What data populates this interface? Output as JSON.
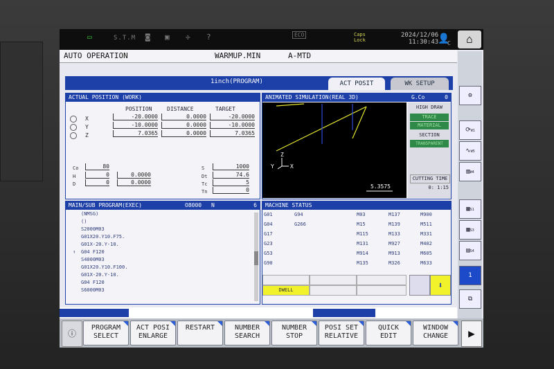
{
  "status": {
    "sim_label": "S.T.M",
    "eco": "ECO",
    "caps_line1": "Caps",
    "caps_line2": "Lock",
    "date": "2024/12/06",
    "time": "11:30:43",
    "user_badge": "C"
  },
  "mode": {
    "operation": "AUTO OPERATION",
    "program_file": "WARMUP.MIN",
    "mtd": "A-MTD"
  },
  "tabs": {
    "program_unit": "1inch(PROGRAM)",
    "act_posit": "ACT POSIT",
    "wk_setup": "WK SETUP"
  },
  "actual_position": {
    "title": "ACTUAL POSITION (WORK)",
    "headers": [
      "POSITION",
      "DISTANCE",
      "TARGET"
    ],
    "rows": [
      {
        "axis": "X",
        "position": "-20.0000",
        "distance": "0.0000",
        "target": "-20.0000"
      },
      {
        "axis": "Y",
        "position": "-10.0000",
        "distance": "0.0000",
        "target": "-10.0000"
      },
      {
        "axis": "Z",
        "position": "7.0365",
        "distance": "0.0000",
        "target": "7.0365"
      }
    ],
    "co_label": "Co",
    "co_value": "80",
    "h_label": "H",
    "h_num": "0",
    "h_value": "0.0000",
    "d_label": "D",
    "d_num": "0",
    "d_value": "0.0000",
    "s_label": "S",
    "s_value": "1000",
    "dt_label": "Dt",
    "dt_value": "74.6",
    "tc_label": "Tc",
    "tc_value": "5",
    "tn_label": "Tn",
    "tn_value": "0"
  },
  "simulation": {
    "title": "ANIMATED SIMULATION(REAL 3D)",
    "gco_label": "G.Co",
    "gco_value": "0",
    "high_draw": "HIGH DRAW",
    "trace": "TRACE",
    "material": "MATERIAL",
    "section": "SECTION",
    "transparent": "TRANSPARENT",
    "cutting_time_label": "CUTTING TIME",
    "cutting_time": "0: 1:15",
    "scale": "5.3575",
    "axis_z": "Z",
    "axis_y": "Y",
    "axis_x": "X"
  },
  "program": {
    "title": "MAIN/SUB PROGRAM(EXEC)",
    "onum": "O8000",
    "n_label": "N",
    "count": "6",
    "lines": [
      "(NMSG)",
      "()",
      "S2000M03",
      "G01X20.Y10.F75.",
      "G01X-20.Y-10.",
      "G04 F120",
      "S4000M03",
      "G01X20.Y10.F100.",
      "G01X-20.Y-10.",
      "G04 F120",
      "S6000M03"
    ]
  },
  "machine_status": {
    "title": "MACHINE STATUS",
    "col1": [
      "G01",
      "G04",
      "G17",
      "G23",
      "G53",
      "G90"
    ],
    "col2": [
      "G94",
      "G266",
      "",
      "",
      "",
      ""
    ],
    "col3": [
      "M03",
      "M15",
      "M115",
      "M131",
      "M914",
      "M135"
    ],
    "col4": [
      "M137",
      "M139",
      "M133",
      "M927",
      "M913",
      "M326"
    ],
    "col5": [
      "M900",
      "M511",
      "M331",
      "M402",
      "M605",
      "M633"
    ],
    "dwell": "DWELL"
  },
  "side": {
    "w1": "W1",
    "w5": "W5",
    "w4": "W4",
    "s1": "S1",
    "s3": "S3",
    "s4": "S4",
    "page": "1"
  },
  "softkeys": {
    "info": "ⓘ",
    "keys": [
      [
        "PROGRAM",
        "SELECT"
      ],
      [
        "ACT POSI",
        "ENLARGE"
      ],
      [
        "RESTART",
        ""
      ],
      [
        "NUMBER",
        "SEARCH"
      ],
      [
        "NUMBER",
        "STOP"
      ],
      [
        "POSI SET",
        "RELATIVE"
      ],
      [
        "QUICK",
        "EDIT"
      ],
      [
        "WINDOW",
        "CHANGE"
      ]
    ]
  },
  "colors": {
    "header_blue": "#1d40a8",
    "active_green": "#2f8a4a",
    "dwell_yellow": "#f2f22a"
  }
}
